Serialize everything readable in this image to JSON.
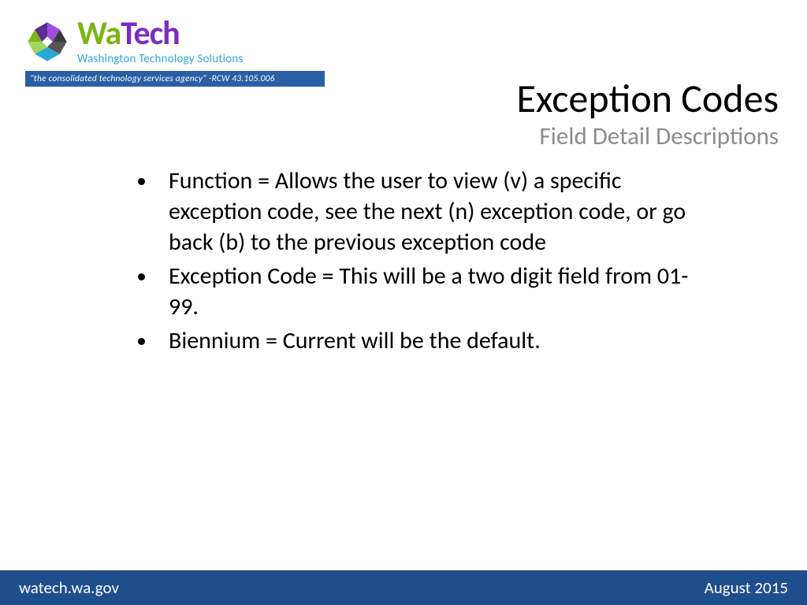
{
  "logo": {
    "wa": "Wa",
    "tech": "Tech",
    "subtitle": "Washington Technology Solutions",
    "tagline": "\"the consolidated technology services agency\" -RCW 43.105.006"
  },
  "title": {
    "main": "Exception Codes",
    "sub": "Field Detail Descriptions"
  },
  "bullets": [
    "Function = Allows the user to view (v) a specific exception code, see the next (n) exception code, or go back (b) to the previous exception code",
    "Exception Code = This will be a two digit field from 01-99.",
    "Biennium = Current will be the default."
  ],
  "footer": {
    "left": "watech.wa.gov",
    "right": "August 2015"
  }
}
